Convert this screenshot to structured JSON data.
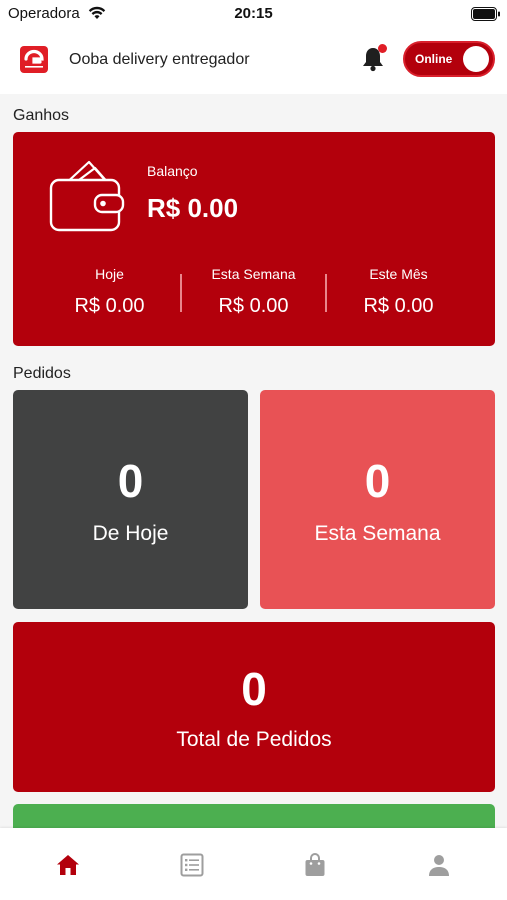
{
  "status_bar": {
    "carrier": "Operadora",
    "time": "20:15"
  },
  "header": {
    "title": "Ooba delivery entregador",
    "online_label": "Online",
    "online": true
  },
  "earnings": {
    "section_title": "Ganhos",
    "balance_label": "Balanço",
    "balance_value": "R$ 0.00",
    "stats": [
      {
        "label": "Hoje",
        "value": "R$ 0.00"
      },
      {
        "label": "Esta Semana",
        "value": "R$ 0.00"
      },
      {
        "label": "Este Mês",
        "value": "R$ 0.00"
      }
    ]
  },
  "orders": {
    "section_title": "Pedidos",
    "today": {
      "count": "0",
      "label": "De Hoje"
    },
    "week": {
      "count": "0",
      "label": "Esta Semana"
    },
    "total": {
      "count": "0",
      "label": "Total de Pedidos"
    }
  },
  "nav": {
    "items": [
      "home-icon",
      "list-icon",
      "bag-icon",
      "person-icon"
    ]
  },
  "colors": {
    "brand_red": "#b3000c",
    "light_red": "#e85255",
    "dark_gray": "#414242",
    "green": "#4caf50",
    "nav_active": "#b3000c",
    "nav_inactive": "#9e9e9e"
  }
}
